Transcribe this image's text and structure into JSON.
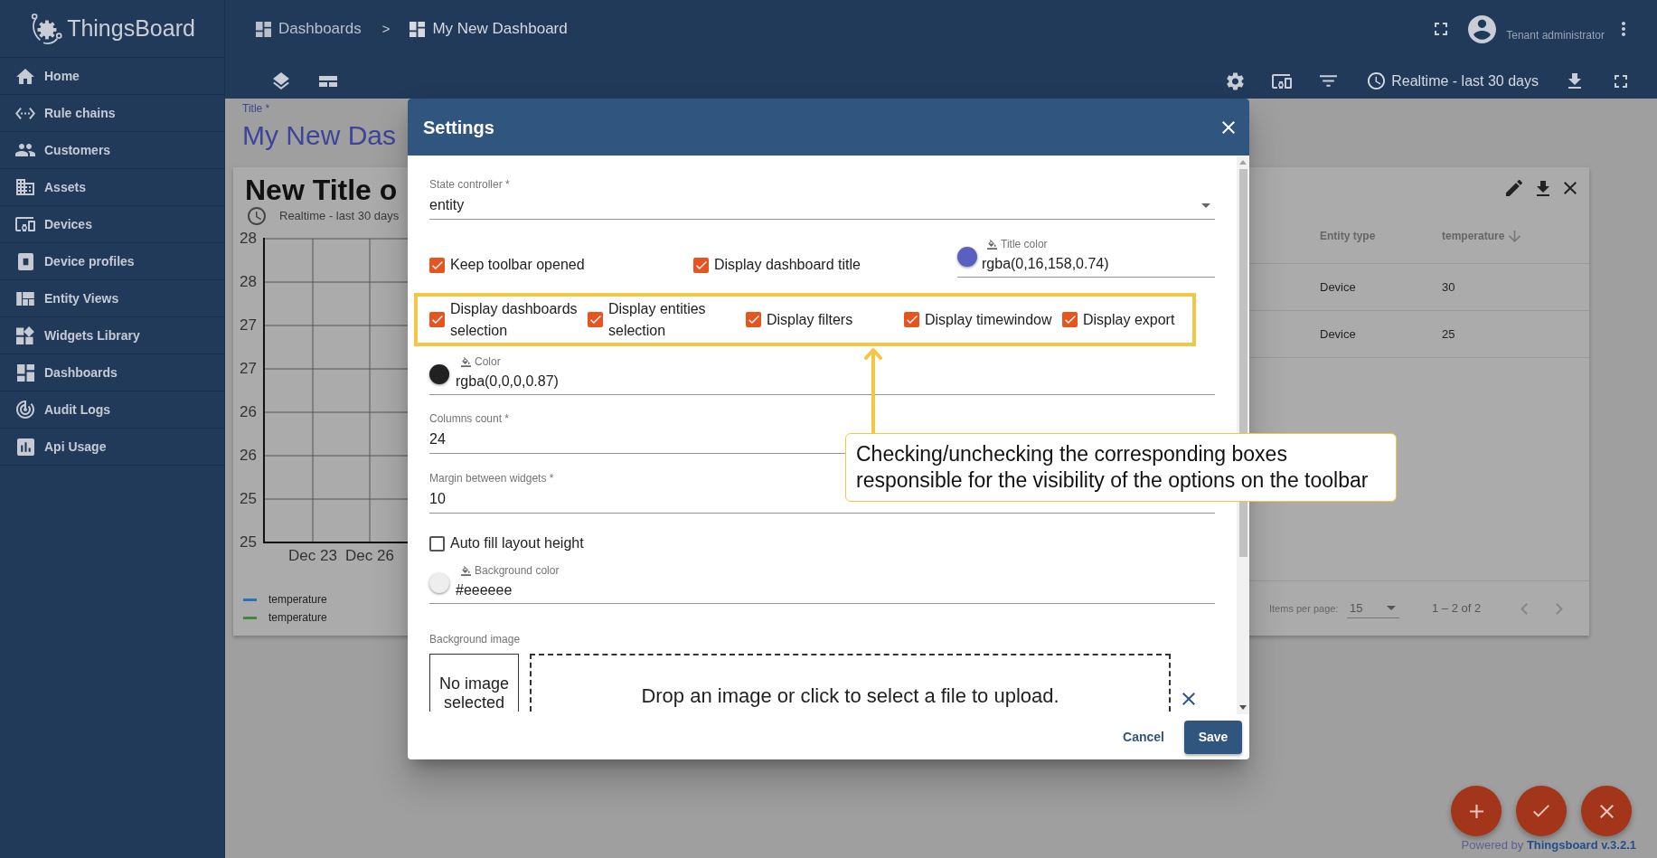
{
  "sidebar": {
    "logo": "ThingsBoard",
    "items": [
      {
        "label": "Home",
        "selected": false
      },
      {
        "label": "Rule chains",
        "selected": false
      },
      {
        "label": "Customers",
        "selected": false
      },
      {
        "label": "Assets",
        "selected": false
      },
      {
        "label": "Devices",
        "selected": false
      },
      {
        "label": "Device profiles",
        "selected": false
      },
      {
        "label": "Entity Views",
        "selected": false
      },
      {
        "label": "Widgets Library",
        "selected": false
      },
      {
        "label": "Dashboards",
        "selected": false
      },
      {
        "label": "Audit Logs",
        "selected": false
      },
      {
        "label": "Api Usage",
        "selected": false
      }
    ]
  },
  "header": {
    "breadcrumbs": [
      "Dashboards",
      "My New Dashboard"
    ],
    "separator": ">",
    "user_role": "Tenant administrator"
  },
  "dashboard_toolbar": {
    "timewindow": "Realtime - last 30 days"
  },
  "dashboard": {
    "title_label": "Title *",
    "title": "My New Das",
    "chart_widget": {
      "title": "New Title o",
      "timewindow": "Realtime - last 30 days",
      "y_axis_labels": [
        "28",
        "28",
        "27",
        "27",
        "26",
        "26",
        "25",
        "25"
      ],
      "x_axis_labels": [
        "Dec 23",
        "Dec 26"
      ],
      "legend": [
        {
          "label": "temperature",
          "color": "#2b72b8"
        },
        {
          "label": "temperature",
          "color": "#3f8a3f"
        }
      ]
    },
    "table_widget": {
      "columns": [
        {
          "label": "Entity type",
          "sorted": false
        },
        {
          "label": "temperature",
          "sorted": true
        }
      ],
      "rows": [
        [
          "Device",
          "30"
        ],
        [
          "Device",
          "25"
        ]
      ],
      "paginator": {
        "label": "Items per page:",
        "page_size": "15",
        "range": "1 – 2 of 2"
      }
    }
  },
  "settings_dialog": {
    "title": "Settings",
    "state_controller": {
      "label": "State controller *",
      "value": "entity"
    },
    "top_checkboxes": [
      {
        "label": "Keep toolbar opened",
        "checked": true
      },
      {
        "label": "Display dashboard title",
        "checked": true
      }
    ],
    "title_color": {
      "label": "Title color",
      "value": "rgba(0,16,158,0.74)",
      "color": "#5a60c0"
    },
    "toolbar_checkboxes": [
      {
        "label": "Display dashboards selection",
        "checked": true
      },
      {
        "label": "Display entities selection",
        "checked": true
      },
      {
        "label": "Display filters",
        "checked": true
      },
      {
        "label": "Display timewindow",
        "checked": true
      },
      {
        "label": "Display export",
        "checked": true
      }
    ],
    "color": {
      "label": "Color",
      "value": "rgba(0,0,0,0.87)",
      "color": "#212121"
    },
    "columns_count": {
      "label": "Columns count *",
      "value": "24"
    },
    "margin": {
      "label": "Margin between widgets *",
      "value": "10"
    },
    "auto_fill": {
      "label": "Auto fill layout height",
      "checked": false
    },
    "background_color": {
      "label": "Background color",
      "value": "#eeeeee",
      "color": "#eeeeee"
    },
    "background_image": {
      "label": "Background image",
      "preview": "No image selected",
      "drop_text": "Drop an image or click to select a file to upload."
    },
    "buttons": [
      {
        "label": "Cancel",
        "kind": "text"
      },
      {
        "label": "Save",
        "kind": "filled"
      }
    ]
  },
  "annotation": {
    "text": "Checking/unchecking the corresponding boxes responsible for the visibility of the options on the toolbar"
  },
  "footer": {
    "powered_by": "Powered by **Thingsboard v.3.2.1**"
  }
}
